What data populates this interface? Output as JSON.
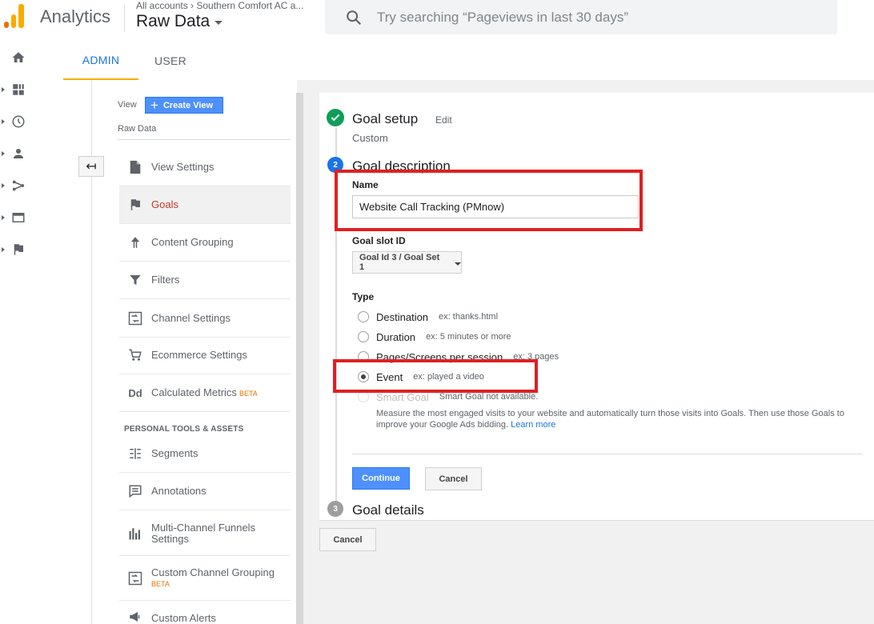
{
  "header": {
    "app_name": "Analytics",
    "accounts": "All accounts › Southern Comfort AC a...",
    "view_name": "Raw Data",
    "search_placeholder": "Try searching “Pageviews in last 30 days”"
  },
  "tabs": [
    {
      "label": "ADMIN",
      "active": true
    },
    {
      "label": "USER",
      "active": false
    }
  ],
  "nav": {
    "view_label": "View",
    "create_view_label": "Create View",
    "view_name": "Raw Data",
    "items": [
      {
        "label": "View Settings",
        "icon": "document-icon"
      },
      {
        "label": "Goals",
        "icon": "flag-icon",
        "active": true
      },
      {
        "label": "Content Grouping",
        "icon": "grouping-icon"
      },
      {
        "label": "Filters",
        "icon": "filter-icon"
      },
      {
        "label": "Channel Settings",
        "icon": "channel-icon"
      },
      {
        "label": "Ecommerce Settings",
        "icon": "cart-icon"
      },
      {
        "label": "Calculated Metrics",
        "icon": "dd-icon",
        "badge": "BETA"
      }
    ],
    "section_heading": "PERSONAL TOOLS & ASSETS",
    "personal_items": [
      {
        "label": "Segments",
        "icon": "segments-icon"
      },
      {
        "label": "Annotations",
        "icon": "annotation-icon"
      },
      {
        "label": "Multi-Channel Funnels Settings",
        "icon": "bar-chart-icon"
      },
      {
        "label": "Custom Channel Grouping",
        "icon": "channel-icon",
        "badge": "BETA"
      },
      {
        "label": "Custom Alerts",
        "icon": "megaphone-icon"
      }
    ]
  },
  "goal": {
    "step1_title": "Goal setup",
    "step1_edit": "Edit",
    "step1_sub": "Custom",
    "step2_num": "2",
    "step2_title": "Goal description",
    "name_label": "Name",
    "name_value": "Website Call Tracking (PMnow)",
    "slot_label": "Goal slot ID",
    "slot_value": "Goal Id 3 / Goal Set 1",
    "type_label": "Type",
    "types": [
      {
        "label": "Destination",
        "example": "ex: thanks.html",
        "checked": false,
        "disabled": false
      },
      {
        "label": "Duration",
        "example": "ex: 5 minutes or more",
        "checked": false,
        "disabled": false
      },
      {
        "label": "Pages/Screens per session",
        "example": "ex: 3 pages",
        "checked": false,
        "disabled": false
      },
      {
        "label": "Event",
        "example": "ex: played a video",
        "checked": true,
        "disabled": false
      },
      {
        "label": "Smart Goal",
        "example": "Smart Goal not available.",
        "checked": false,
        "disabled": true
      }
    ],
    "smart_desc": "Measure the most engaged visits to your website and automatically turn those visits into Goals. Then use those Goals to improve your Google Ads bidding.",
    "learn_more": "Learn more",
    "continue_label": "Continue",
    "cancel_label": "Cancel",
    "step3_num": "3",
    "step3_title": "Goal details",
    "outer_cancel_label": "Cancel"
  },
  "colors": {
    "accent_blue": "#1a73e8",
    "button_blue": "#4d90fe",
    "logo_orange": "#F9AB00",
    "check_green": "#0f9d58",
    "annotation_red": "#e02020"
  }
}
